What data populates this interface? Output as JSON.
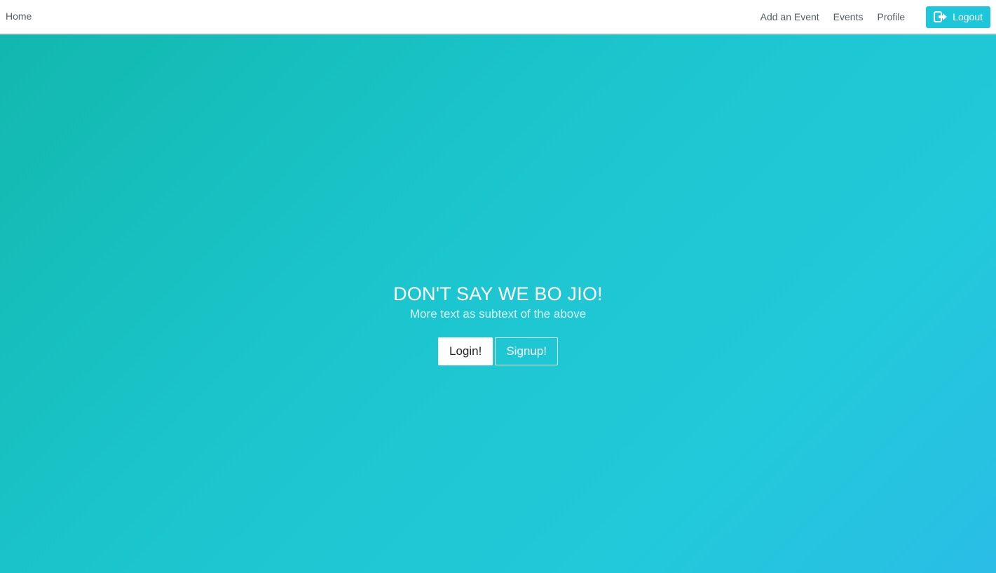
{
  "navbar": {
    "home_label": "Home",
    "links": {
      "add_event": "Add an Event",
      "events": "Events",
      "profile": "Profile"
    },
    "logout": {
      "label": "Logout",
      "icon": "sign-out-icon"
    }
  },
  "hero": {
    "title": "DON'T SAY WE BO JIO!",
    "subtitle": "More text as subtext of the above",
    "login_label": "Login!",
    "signup_label": "Signup!"
  },
  "colors": {
    "accent": "#1cc6db",
    "gradient_start": "#12b8ae",
    "gradient_end": "#2abde6"
  }
}
